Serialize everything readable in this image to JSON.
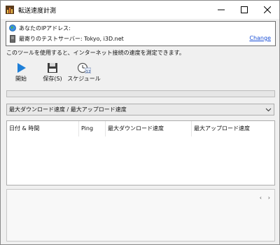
{
  "window": {
    "title": "転送速度計測"
  },
  "info": {
    "ip_label": "あなたのIPアドレス:",
    "server_label": "最寄りのテストサーバー: Tokyo, i3D.net",
    "change_link": "Change"
  },
  "description": "このツールを使用すると、インターネット接続の速度を測定できます。",
  "toolbar": {
    "start_label": "開始",
    "save_label": "保存(S)",
    "schedule_label": "スケジュール",
    "schedule_badge": "12"
  },
  "progress": {
    "value": 0
  },
  "mode_select": {
    "selected": "最大ダウンロード速度 / 最大アップロード速度"
  },
  "table": {
    "columns": [
      "日付 & 時間",
      "Ping",
      "最大ダウンロード速度",
      "最大アップロード速度"
    ],
    "rows": []
  },
  "pager": {
    "prev": "‹",
    "next": "›"
  },
  "colors": {
    "link": "#1a4fd6",
    "play": "#1e7fd8"
  }
}
